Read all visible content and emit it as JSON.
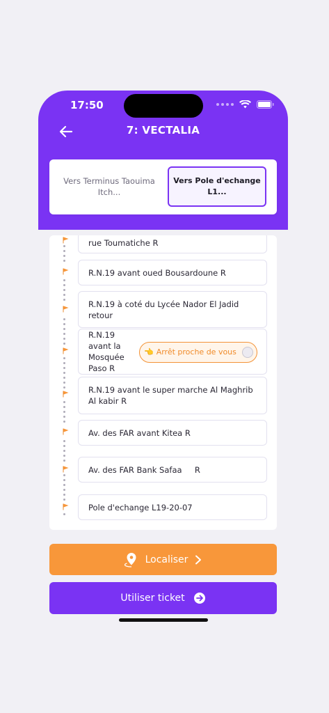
{
  "status": {
    "time": "17:50"
  },
  "header": {
    "title": "7: VECTALIA"
  },
  "tabs": [
    {
      "label": "Vers Terminus Taouima Itch...",
      "selected": false
    },
    {
      "label": "Vers Pole d'echange L1...",
      "selected": true
    }
  ],
  "stops": [
    {
      "label": "rue Toumatiche R"
    },
    {
      "label": "R.N.19 avant oued Bousardoune R"
    },
    {
      "label": "R.N.19 à coté du Lycée Nador El Jadid retour"
    },
    {
      "label": "R.N.19 avant la Mosquée Paso R",
      "badge": "Arrêt proche de vous"
    },
    {
      "label": "R.N.19 avant le super marche Al Maghrib Al kabir R"
    },
    {
      "label": "Av. des FAR avant Kitea R"
    },
    {
      "label": "Av. des FAR Bank Safaa     R"
    },
    {
      "label": "Pole d'echange L19-20-07"
    }
  ],
  "near_badge_icon": "👈",
  "actions": {
    "locate_label": "Localiser",
    "ticket_label": "Utiliser ticket"
  },
  "colors": {
    "primary": "#7a33f3",
    "accent": "#f8973a",
    "background": "#f1f0f5"
  },
  "icons": [
    "back-arrow-icon",
    "wifi-icon",
    "battery-icon",
    "flag-icon",
    "location-pin-icon",
    "chevron-right-icon",
    "arrow-circle-right-icon",
    "avatar-icon"
  ]
}
